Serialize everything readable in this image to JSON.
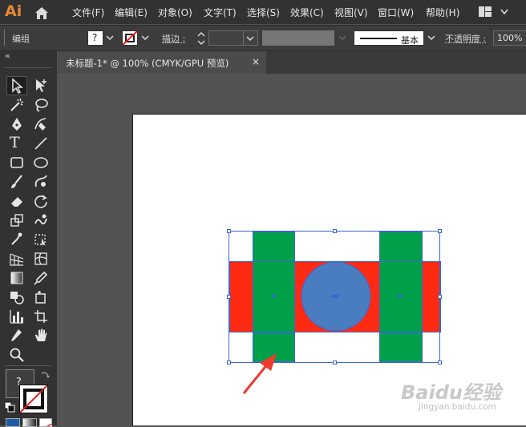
{
  "app": {
    "logo_text": "Ai",
    "accent": "#e5892f"
  },
  "menu": [
    "文件(F)",
    "编辑(E)",
    "对象(O)",
    "文字(T)",
    "选择(S)",
    "效果(C)",
    "视图(V)",
    "窗口(W)",
    "帮助(H)"
  ],
  "control_bar": {
    "selection_label": "编组",
    "fill_value": "?",
    "stroke_label": "描边 :",
    "brush_style": "基本",
    "opacity_label": "不透明度 :",
    "opacity_value": "100%"
  },
  "panel": {
    "collapse": "«"
  },
  "document_tab": {
    "title": "未标题-1* @ 100% (CMYK/GPU 预览)",
    "close": "×"
  },
  "tools_bottom": {
    "fill_box": "?"
  },
  "artwork": {
    "colors": {
      "red": "#ff2a12",
      "green": "#00a04a",
      "blue": "#4a7cc0",
      "selection": "#3b66d6",
      "arrow": "#ee3b2e"
    }
  },
  "watermark": {
    "brand": "Baidu经验",
    "url": "jingyan.baidu.com"
  }
}
